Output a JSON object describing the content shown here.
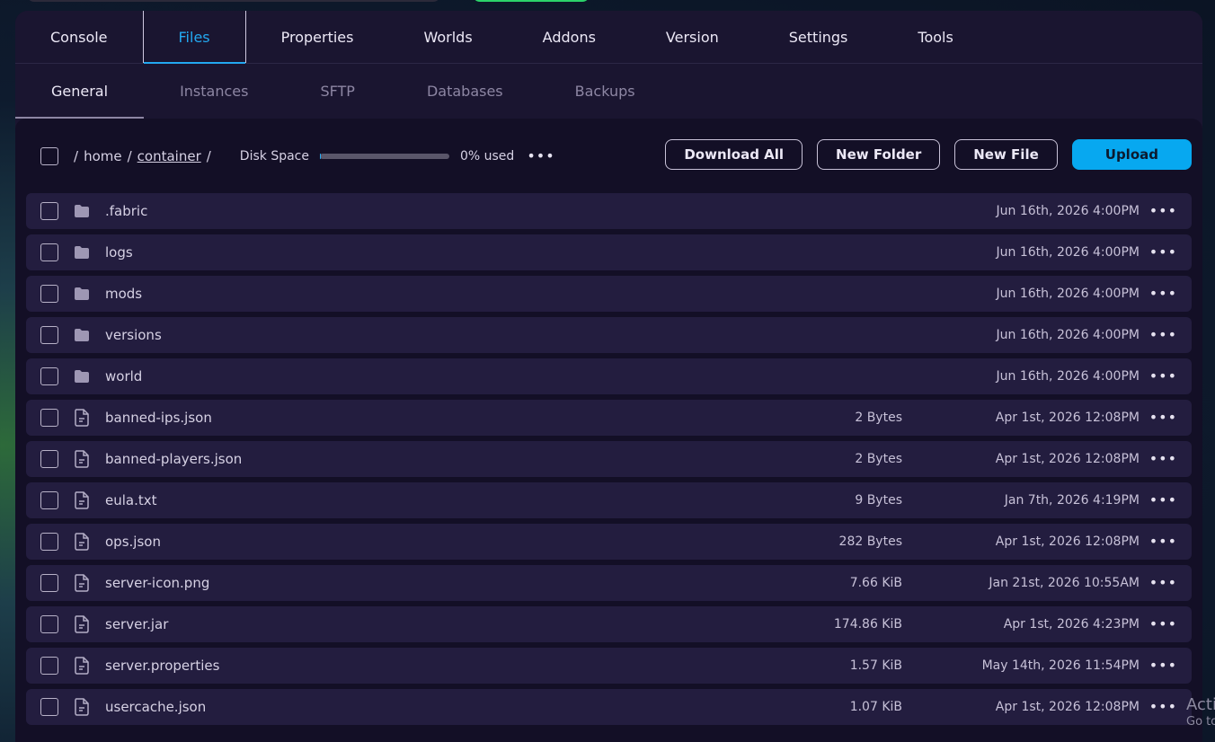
{
  "main_tabs": [
    {
      "label": "Console",
      "active": false
    },
    {
      "label": "Files",
      "active": true
    },
    {
      "label": "Properties",
      "active": false
    },
    {
      "label": "Worlds",
      "active": false
    },
    {
      "label": "Addons",
      "active": false
    },
    {
      "label": "Version",
      "active": false
    },
    {
      "label": "Settings",
      "active": false
    },
    {
      "label": "Tools",
      "active": false
    }
  ],
  "sub_tabs": [
    {
      "label": "General",
      "active": true
    },
    {
      "label": "Instances",
      "active": false
    },
    {
      "label": "SFTP",
      "active": false
    },
    {
      "label": "Databases",
      "active": false
    },
    {
      "label": "Backups",
      "active": false
    }
  ],
  "toolbar": {
    "path_sep": "/",
    "path_home": "home",
    "path_container": "container",
    "disk_label": "Disk Space",
    "disk_used_label": "0% used",
    "disk_used_fraction": 0.01,
    "more": "•••",
    "download_all": "Download All",
    "new_folder": "New Folder",
    "new_file": "New File",
    "upload": "Upload"
  },
  "files": [
    {
      "name": ".fabric",
      "type": "folder",
      "size": "",
      "date": "Jun 16th, 2026 4:00PM"
    },
    {
      "name": "logs",
      "type": "folder",
      "size": "",
      "date": "Jun 16th, 2026 4:00PM"
    },
    {
      "name": "mods",
      "type": "folder",
      "size": "",
      "date": "Jun 16th, 2026 4:00PM"
    },
    {
      "name": "versions",
      "type": "folder",
      "size": "",
      "date": "Jun 16th, 2026 4:00PM"
    },
    {
      "name": "world",
      "type": "folder",
      "size": "",
      "date": "Jun 16th, 2026 4:00PM"
    },
    {
      "name": "banned-ips.json",
      "type": "file",
      "size": "2 Bytes",
      "date": "Apr 1st, 2026 12:08PM"
    },
    {
      "name": "banned-players.json",
      "type": "file",
      "size": "2 Bytes",
      "date": "Apr 1st, 2026 12:08PM"
    },
    {
      "name": "eula.txt",
      "type": "file",
      "size": "9 Bytes",
      "date": "Jan 7th, 2026 4:19PM"
    },
    {
      "name": "ops.json",
      "type": "file",
      "size": "282 Bytes",
      "date": "Apr 1st, 2026 12:08PM"
    },
    {
      "name": "server-icon.png",
      "type": "file",
      "size": "7.66 KiB",
      "date": "Jan 21st, 2026 10:55AM"
    },
    {
      "name": "server.jar",
      "type": "file",
      "size": "174.86 KiB",
      "date": "Apr 1st, 2026 4:23PM"
    },
    {
      "name": "server.properties",
      "type": "file",
      "size": "1.57 KiB",
      "date": "May 14th, 2026 11:54PM"
    },
    {
      "name": "usercache.json",
      "type": "file",
      "size": "1.07 KiB",
      "date": "Apr 1st, 2026 12:08PM"
    }
  ],
  "watermark": {
    "line1": "Acti",
    "line2": "Go to"
  },
  "colors": {
    "accent": "#07a8f0",
    "panel": "#1a1530",
    "row": "#231d3f"
  }
}
